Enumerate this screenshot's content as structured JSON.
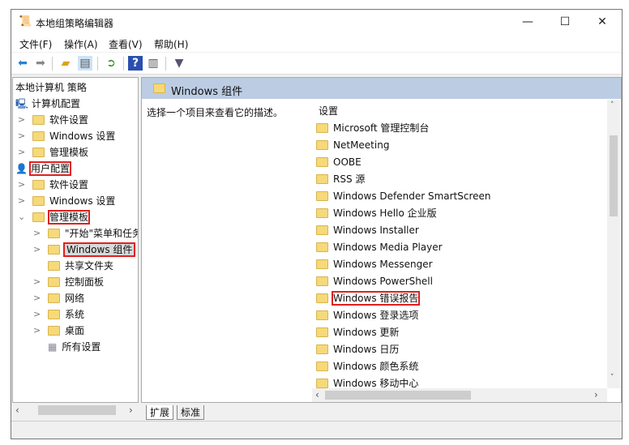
{
  "window": {
    "title": "本地组策略编辑器",
    "minimize": "—",
    "maximize": "☐",
    "close": "✕"
  },
  "menu": [
    "文件(F)",
    "操作(A)",
    "查看(V)",
    "帮助(H)"
  ],
  "toolbar": [
    "back-icon",
    "forward-icon",
    "up-folder-icon",
    "show-hide-tree-icon",
    "export-list-icon",
    "help-icon",
    "show-hide-action-pane-icon",
    "filter-icon"
  ],
  "tree": {
    "root": "本地计算机 策略",
    "items": [
      {
        "label": "计算机配置",
        "level": 0,
        "icon": "computer"
      },
      {
        "label": "软件设置",
        "level": 1,
        "chev": ">"
      },
      {
        "label": "Windows 设置",
        "level": 1,
        "chev": ">"
      },
      {
        "label": "管理模板",
        "level": 1,
        "chev": ">"
      },
      {
        "label": "用户配置",
        "level": 0,
        "icon": "user",
        "highlight": true
      },
      {
        "label": "软件设置",
        "level": 1,
        "chev": ">"
      },
      {
        "label": "Windows 设置",
        "level": 1,
        "chev": ">"
      },
      {
        "label": "管理模板",
        "level": 1,
        "chev": "v",
        "highlight": true
      },
      {
        "label": "\"开始\"菜单和任务栏",
        "level": 2,
        "chev": ">"
      },
      {
        "label": "Windows 组件",
        "level": 2,
        "chev": ">",
        "highlight": true,
        "selected": true
      },
      {
        "label": "共享文件夹",
        "level": 2
      },
      {
        "label": "控制面板",
        "level": 2,
        "chev": ">"
      },
      {
        "label": "网络",
        "level": 2,
        "chev": ">"
      },
      {
        "label": "系统",
        "level": 2,
        "chev": ">"
      },
      {
        "label": "桌面",
        "level": 2,
        "chev": ">"
      },
      {
        "label": "所有设置",
        "level": 2,
        "icon": "settings"
      }
    ]
  },
  "content": {
    "header": "Windows 组件",
    "description": "选择一个项目来查看它的描述。",
    "column": "设置",
    "items": [
      "Microsoft 管理控制台",
      "NetMeeting",
      "OOBE",
      "RSS 源",
      "Windows Defender SmartScreen",
      "Windows Hello 企业版",
      "Windows Installer",
      "Windows Media Player",
      "Windows Messenger",
      "Windows PowerShell",
      "Windows 错误报告",
      "Windows 登录选项",
      "Windows 更新",
      "Windows 日历",
      "Windows 颜色系统",
      "Windows 移动中心"
    ],
    "highlighted_item": "Windows 错误报告"
  },
  "tabs": [
    "扩展",
    "标准"
  ]
}
